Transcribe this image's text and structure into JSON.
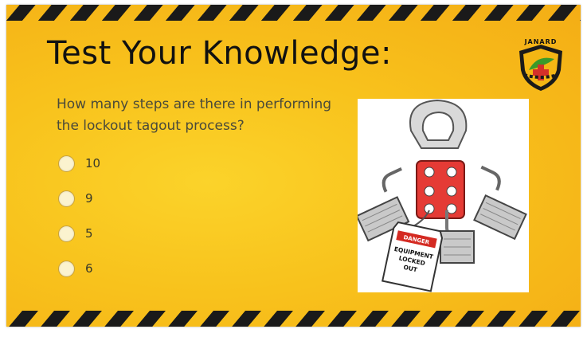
{
  "slide": {
    "title": "Test Your Knowledge:",
    "question": "How many steps are there in performing the lockout tagout process?",
    "options": [
      {
        "label": "10"
      },
      {
        "label": "9"
      },
      {
        "label": "5"
      },
      {
        "label": "6"
      }
    ],
    "logo_text": "JANARD",
    "tag_text_lines": [
      "EQUIPMENT",
      "LOCKED",
      "OUT"
    ],
    "tag_header": "DANGER"
  },
  "colors": {
    "background": "#f8c21c",
    "stripe_dark": "#1a1a1a",
    "hasp_red": "#e53b35",
    "title": "#111111"
  }
}
